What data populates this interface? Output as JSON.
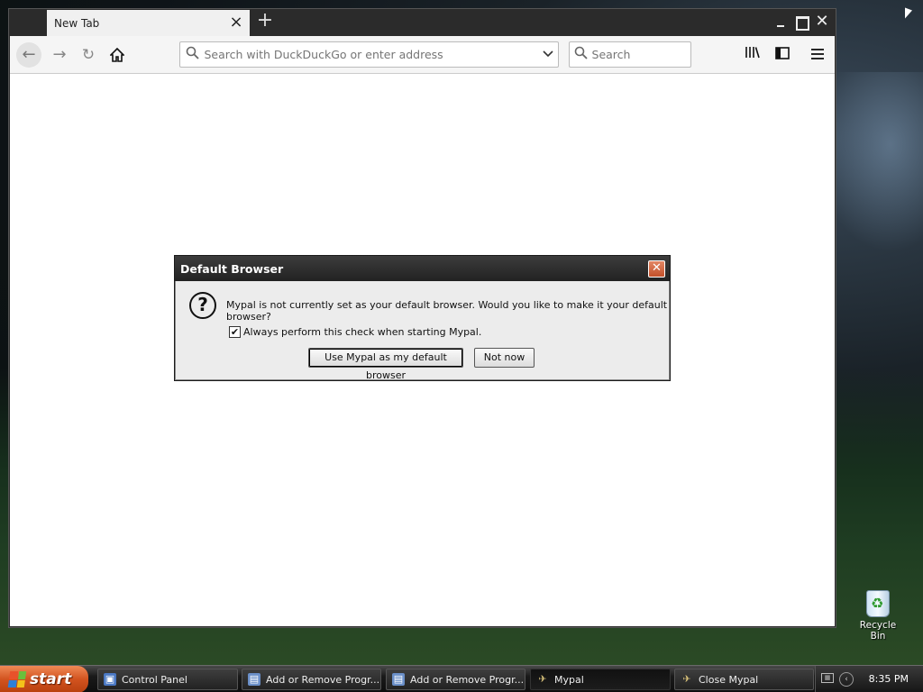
{
  "browser": {
    "tab": {
      "title": "New Tab"
    },
    "window_controls": {
      "minimize": "",
      "maximize": "",
      "close": "✕"
    },
    "url_placeholder": "Search with DuckDuckGo or enter address",
    "search_placeholder": "Search"
  },
  "dialog": {
    "title": "Default Browser",
    "message": "Mypal is not currently set as your default browser. Would you like to make it your default browser?",
    "checkbox_label": "Always perform this check when starting Mypal.",
    "checkbox_checked": true,
    "primary_button": "Use Mypal as my default browser",
    "secondary_button": "Not now"
  },
  "desktop": {
    "recycle_bin_label": "Recycle Bin"
  },
  "taskbar": {
    "start_label": "start",
    "items": [
      {
        "label": "Control Panel",
        "icon": "control-panel-icon",
        "active": false
      },
      {
        "label": "Add or Remove Progr...",
        "icon": "add-remove-programs-icon",
        "active": false
      },
      {
        "label": "Add or Remove Progr...",
        "icon": "add-remove-programs-icon",
        "active": false
      },
      {
        "label": "Mypal",
        "icon": "mypal-icon",
        "active": true
      },
      {
        "label": "Close Mypal",
        "icon": "mypal-icon",
        "active": false
      }
    ],
    "clock": "8:35 PM"
  }
}
